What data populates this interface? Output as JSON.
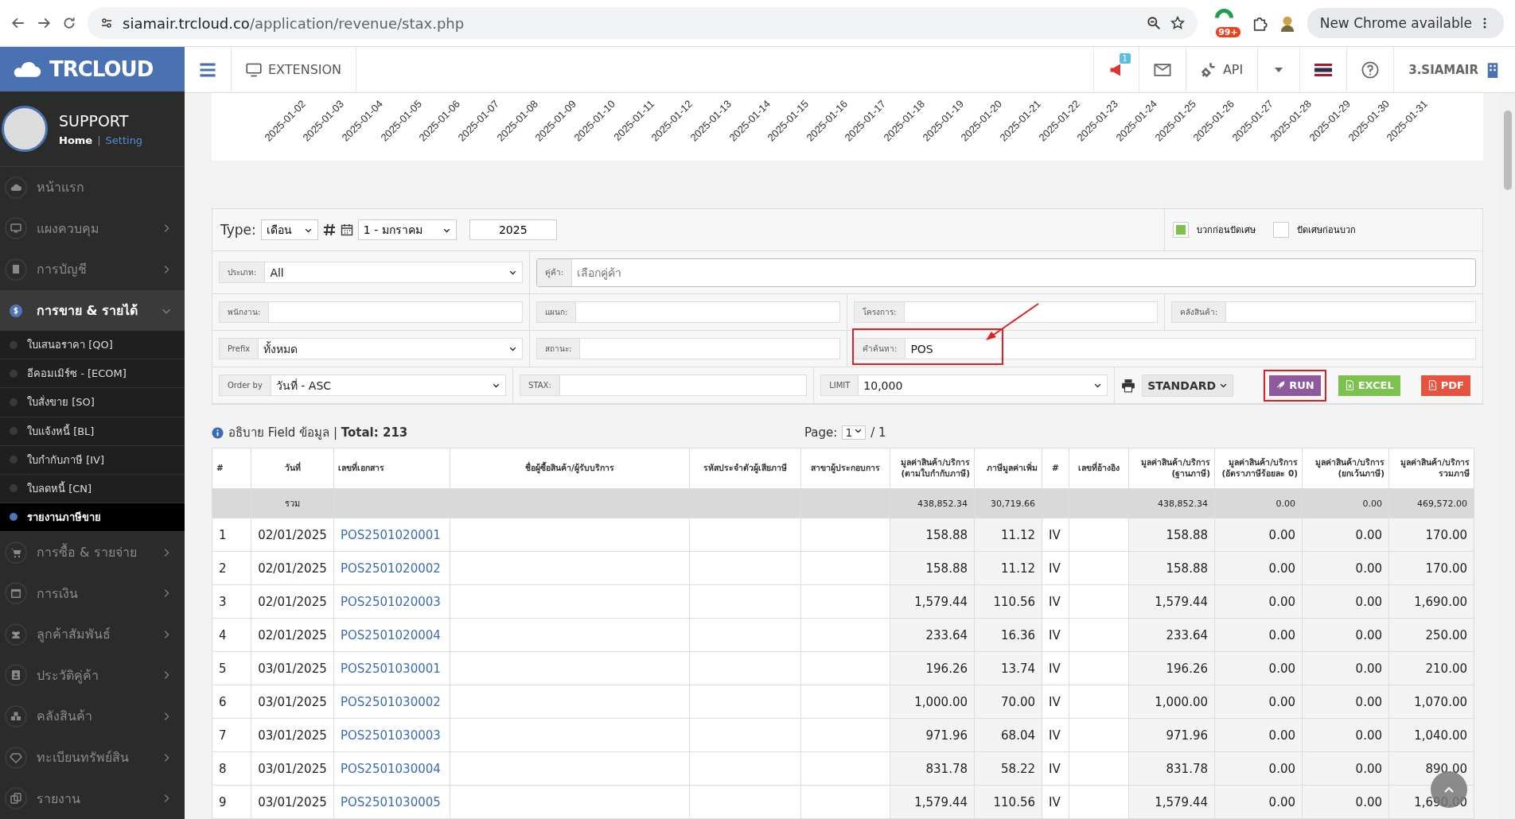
{
  "browser": {
    "url_host": "siamair.trcloud.co",
    "url_path": "/application/revenue/stax.php",
    "extension_badge": "99+",
    "update_button": "New Chrome available"
  },
  "header": {
    "logo": "TRCLOUD",
    "extension": "EXTENSION",
    "notification_badge": "1",
    "api": "API",
    "company": "3.SIAMAIR"
  },
  "profile": {
    "name": "SUPPORT",
    "home": "Home",
    "separator": "|",
    "setting": "Setting"
  },
  "sidebar": {
    "items": [
      {
        "label": "หน้าแรก",
        "expandable": false,
        "expanded": false,
        "selected": false
      },
      {
        "label": "แผงควบคุม",
        "expandable": true,
        "expanded": false,
        "selected": false
      },
      {
        "label": "การบัญชี",
        "expandable": true,
        "expanded": false,
        "selected": false
      },
      {
        "label": "การขาย & รายได้",
        "expandable": true,
        "expanded": true,
        "selected": true,
        "children": [
          {
            "label": "ใบเสนอราคา [QO]",
            "selected": false
          },
          {
            "label": "อีคอมเมิร์ซ - [ECOM]",
            "selected": false
          },
          {
            "label": "ใบสั่งขาย [SO]",
            "selected": false
          },
          {
            "label": "ใบแจ้งหนี้ [BL]",
            "selected": false
          },
          {
            "label": "ใบกำกับภาษี [IV]",
            "selected": false
          },
          {
            "label": "ใบลดหนี้ [CN]",
            "selected": false
          },
          {
            "label": "รายงานภาษีขาย",
            "selected": true
          }
        ]
      },
      {
        "label": "การซื้อ & รายจ่าย",
        "expandable": true,
        "expanded": false,
        "selected": false
      },
      {
        "label": "การเงิน",
        "expandable": true,
        "expanded": false,
        "selected": false
      },
      {
        "label": "ลูกค้าสัมพันธ์",
        "expandable": true,
        "expanded": false,
        "selected": false
      },
      {
        "label": "ประวัติคู่ค้า",
        "expandable": true,
        "expanded": false,
        "selected": false
      },
      {
        "label": "คลังสินค้า",
        "expandable": true,
        "expanded": false,
        "selected": false
      },
      {
        "label": "ทะเบียนทรัพย์สิน",
        "expandable": true,
        "expanded": false,
        "selected": false
      },
      {
        "label": "รายงาน",
        "expandable": true,
        "expanded": false,
        "selected": false
      }
    ]
  },
  "chart": {
    "x_labels": [
      "2025-01-02",
      "2025-01-03",
      "2025-01-04",
      "2025-01-05",
      "2025-01-06",
      "2025-01-07",
      "2025-01-08",
      "2025-01-09",
      "2025-01-10",
      "2025-01-11",
      "2025-01-12",
      "2025-01-13",
      "2025-01-14",
      "2025-01-15",
      "2025-01-16",
      "2025-01-17",
      "2025-01-18",
      "2025-01-19",
      "2025-01-20",
      "2025-01-21",
      "2025-01-22",
      "2025-01-23",
      "2025-01-24",
      "2025-01-25",
      "2025-01-26",
      "2025-01-27",
      "2025-01-28",
      "2025-01-29",
      "2025-01-30",
      "2025-01-31"
    ]
  },
  "filters": {
    "type_label": "Type:",
    "type_value": "เดือน",
    "month": "1 - มกราคม",
    "year": "2025",
    "checkboxes": [
      {
        "label": "บวกก่อนปัดเศษ",
        "checked": true
      },
      {
        "label": "ปัดเศษก่อนบวก",
        "checked": false
      }
    ],
    "rows": [
      [
        {
          "kind": "select",
          "label": "ประเภท:",
          "value": "All"
        },
        {
          "kind": "input",
          "label": "คู่ค้า:",
          "placeholder": "เลือกคู่ค้า"
        }
      ],
      [
        {
          "kind": "input",
          "label": "พนักงาน:"
        },
        {
          "kind": "input",
          "label": "แผนก:"
        },
        {
          "kind": "input",
          "label": "โครงการ:"
        },
        {
          "kind": "input",
          "label": "คลังสินค้า:"
        }
      ],
      [
        {
          "kind": "select",
          "label": "Prefix",
          "value": "ทั้งหมด"
        },
        {
          "kind": "input",
          "label": "สถานะ:"
        },
        {
          "kind": "input",
          "label": "คำค้นหา:",
          "value": "POS",
          "highlighted": true
        }
      ],
      [
        {
          "kind": "select",
          "label": "Order by",
          "value": "วันที่ - ASC"
        },
        {
          "kind": "input",
          "label": "STAX:"
        },
        {
          "kind": "select",
          "label": "LIMIT",
          "value": "10,000"
        },
        {
          "kind": "actions"
        }
      ]
    ],
    "print_format": "STANDARD",
    "buttons": [
      {
        "kind": "run",
        "label": "RUN",
        "highlighted": true
      },
      {
        "kind": "excel",
        "label": "EXCEL"
      },
      {
        "kind": "pdf",
        "label": "PDF"
      }
    ],
    "annotation_arrow": true
  },
  "summary": {
    "text": "อธิบาย Field ข้อมูล | **Total: 213**",
    "page_label": "Page:",
    "page": "1",
    "page_total": "/ 1"
  },
  "table": {
    "columns": [
      "#",
      "วันที่",
      "เลขที่เอกสาร",
      "ชื่อผู้ซื้อสินค้า/ผู้รับบริการ",
      "รหัสประจำตัวผู้เสียภาษี",
      "สาขาผู้ประกอบการ",
      "มูลค่าสินค้า/บริการ\n(ตามใบกำกับภาษี)",
      "ภาษีมูลค่าเพิ่ม",
      "#",
      "เลขที่อ้างอิง",
      "มูลค่าสินค้า/บริการ\n(ฐานภาษี)",
      "มูลค่าสินค้า/บริการ\n(อัตราภาษีร้อยละ 0)",
      "มูลค่าสินค้า/บริการ\n(ยกเว้นภาษี)",
      "มูลค่าสินค้า/บริการ\nรวมภาษี"
    ],
    "total_row": {
      "label": "รวม",
      "amount": "438,852.34",
      "vat": "30,719.66",
      "base": "438,852.34",
      "zero_rate": "0.00",
      "exempt": "0.00",
      "total": "469,572.00"
    },
    "rows": [
      {
        "no": "1",
        "date": "02/01/2025",
        "doc": "POS2501020001",
        "amount": "158.88",
        "vat": "11.12",
        "code": "IV",
        "base": "158.88",
        "zero_rate": "0.00",
        "exempt": "0.00",
        "total": "170.00"
      },
      {
        "no": "2",
        "date": "02/01/2025",
        "doc": "POS2501020002",
        "amount": "158.88",
        "vat": "11.12",
        "code": "IV",
        "base": "158.88",
        "zero_rate": "0.00",
        "exempt": "0.00",
        "total": "170.00"
      },
      {
        "no": "3",
        "date": "02/01/2025",
        "doc": "POS2501020003",
        "amount": "1,579.44",
        "vat": "110.56",
        "code": "IV",
        "base": "1,579.44",
        "zero_rate": "0.00",
        "exempt": "0.00",
        "total": "1,690.00"
      },
      {
        "no": "4",
        "date": "02/01/2025",
        "doc": "POS2501020004",
        "amount": "233.64",
        "vat": "16.36",
        "code": "IV",
        "base": "233.64",
        "zero_rate": "0.00",
        "exempt": "0.00",
        "total": "250.00"
      },
      {
        "no": "5",
        "date": "03/01/2025",
        "doc": "POS2501030001",
        "amount": "196.26",
        "vat": "13.74",
        "code": "IV",
        "base": "196.26",
        "zero_rate": "0.00",
        "exempt": "0.00",
        "total": "210.00"
      },
      {
        "no": "6",
        "date": "03/01/2025",
        "doc": "POS2501030002",
        "amount": "1,000.00",
        "vat": "70.00",
        "code": "IV",
        "base": "1,000.00",
        "zero_rate": "0.00",
        "exempt": "0.00",
        "total": "1,070.00"
      },
      {
        "no": "7",
        "date": "03/01/2025",
        "doc": "POS2501030003",
        "amount": "971.96",
        "vat": "68.04",
        "code": "IV",
        "base": "971.96",
        "zero_rate": "0.00",
        "exempt": "0.00",
        "total": "1,040.00"
      },
      {
        "no": "8",
        "date": "03/01/2025",
        "doc": "POS2501030004",
        "amount": "831.78",
        "vat": "58.22",
        "code": "IV",
        "base": "831.78",
        "zero_rate": "0.00",
        "exempt": "0.00",
        "total": "890.00"
      },
      {
        "no": "9",
        "date": "03/01/2025",
        "doc": "POS2501030005",
        "amount": "1,579.44",
        "vat": "110.56",
        "code": "IV",
        "base": "1,579.44",
        "zero_rate": "0.00",
        "exempt": "0.00",
        "total": "1,690.00"
      }
    ]
  }
}
